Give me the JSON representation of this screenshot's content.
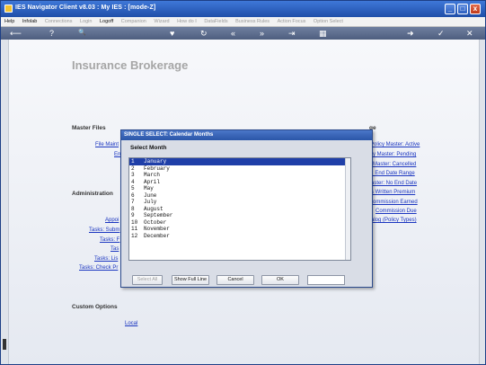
{
  "window": {
    "title": "IES Navigator Client v8.03 :  My IES :      [mode-Z]",
    "minimize": "_",
    "restore": "□",
    "close": "x"
  },
  "menu": {
    "items": [
      "Help",
      "Infolab",
      "Connections",
      "Login",
      "Logoff",
      "Companion",
      "Wizard",
      "How do I",
      "DataFields",
      "Business Rules",
      "Action Focus",
      "Option Select"
    ]
  },
  "toolbar": {
    "icons": [
      "back-arrow-icon",
      "help-icon",
      "search-icon",
      "heart-icon",
      "refresh-icon",
      "rewind-icon",
      "fast-forward-icon",
      "step-end-icon",
      "grid-icon",
      "forward-icon",
      "check-icon",
      "close-icon"
    ],
    "glyphs": [
      "⟵",
      "?",
      "🔍",
      "♥",
      "↻",
      "«",
      "»",
      "⇥",
      "▦",
      "➜",
      "✓",
      "✕"
    ]
  },
  "page": {
    "title": "Insurance Brokerage"
  },
  "sections": {
    "master_files": {
      "heading": "Master Files",
      "links": [
        "File Maint",
        "En"
      ]
    },
    "administration": {
      "heading": "Administration",
      "links": [
        "Appoi",
        "Tasks: Subm",
        "Tasks: F",
        "Tas",
        "Tasks: Lis",
        "Tasks: Check Pr"
      ]
    },
    "right_column": {
      "heading": "ge",
      "links": [
        "Policy Master: Active",
        "cy Master: Pending",
        "Master: Cancelled",
        "r: End Date Range",
        "aster: No End Date",
        "s Written Premium",
        "ommission Earned",
        "Commission Due",
        "alog (Policy Types)"
      ]
    },
    "custom_options": {
      "heading": "Custom Options",
      "links": [
        "Local"
      ]
    }
  },
  "dialog": {
    "title": "SINGLE SELECT: Calendar Months",
    "heading": "Select Month",
    "months": [
      {
        "num": "1",
        "name": "January"
      },
      {
        "num": "2",
        "name": "February"
      },
      {
        "num": "3",
        "name": "March"
      },
      {
        "num": "4",
        "name": "April"
      },
      {
        "num": "5",
        "name": "May"
      },
      {
        "num": "6",
        "name": "June"
      },
      {
        "num": "7",
        "name": "July"
      },
      {
        "num": "8",
        "name": "August"
      },
      {
        "num": "9",
        "name": "September"
      },
      {
        "num": "10",
        "name": "October"
      },
      {
        "num": "11",
        "name": "November"
      },
      {
        "num": "12",
        "name": "December"
      }
    ],
    "selected": "1",
    "buttons": {
      "select_all": "Select All",
      "show_full_line": "Show Full Line",
      "cancel": "Cancel",
      "ok": "OK"
    },
    "field_value": ""
  }
}
